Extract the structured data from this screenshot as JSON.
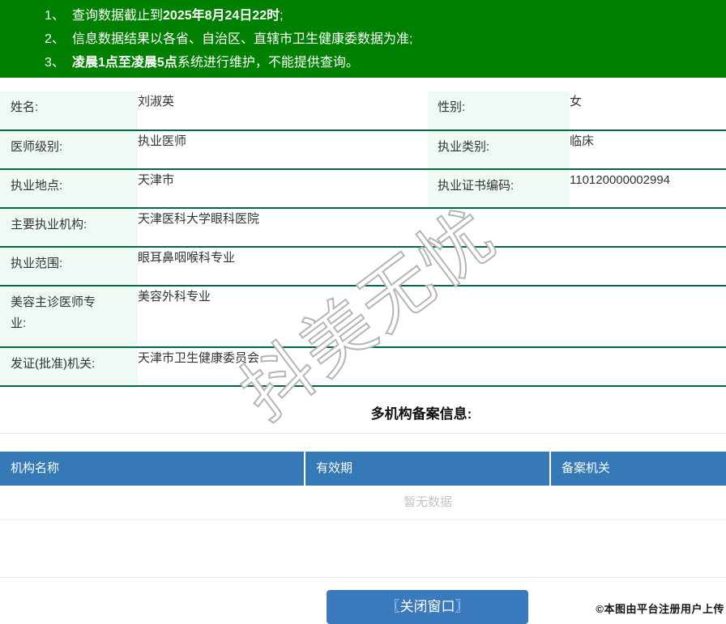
{
  "colors": {
    "banner-green": "#008000",
    "line-green": "#00693e",
    "label-mint": "#effaf4",
    "header-blue": "#3579b6",
    "button-blue": "#3a7abc",
    "empty-gray": "#c0c4cc"
  },
  "notice": {
    "items": [
      {
        "num": "1、",
        "pre": "查询数据截止到",
        "bold": "2025年8月24日22时",
        "post": ";"
      },
      {
        "num": "2、",
        "pre": "信息数据结果以各省、自治区、直辖市卫生健康委数据为准;",
        "bold": "",
        "post": ""
      },
      {
        "num": "3、",
        "pre": "",
        "bold": "凌晨1点至凌晨5点",
        "post": "系统进行维护，不能提供查询。"
      }
    ]
  },
  "info": {
    "rows": [
      {
        "label": "姓名:",
        "value": "刘淑英",
        "label2": "性别:",
        "value2": "女"
      },
      {
        "label": "医师级别:",
        "value": "执业医师",
        "label2": "执业类别:",
        "value2": "临床"
      },
      {
        "label": "执业地点:",
        "value": "天津市",
        "label2": "执业证书编码:",
        "value2": "110120000002994"
      },
      {
        "label": "主要执业机构:",
        "value": "天津医科大学眼科医院"
      },
      {
        "label": "执业范围:",
        "value": "眼耳鼻咽喉科专业"
      },
      {
        "label": "美容主诊医师专业:",
        "value": "美容外科专业"
      },
      {
        "label": "发证(批准)机关:",
        "value": "天津市卫生健康委员会"
      }
    ]
  },
  "registry": {
    "title": "多机构备案信息:",
    "columns": [
      "机构名称",
      "有效期",
      "备案机关"
    ],
    "empty_text": "暂无数据"
  },
  "footer": {
    "close_button": "〖关闭窗口〗",
    "attribution": "©本图由平台注册用户上传"
  },
  "watermark_text": "抖美无忧"
}
